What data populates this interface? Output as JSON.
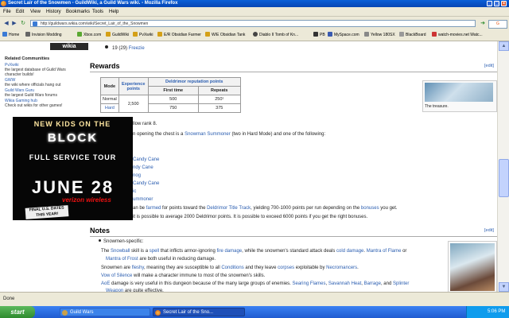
{
  "window": {
    "title": "Secret Lair of the Snowmen - GuildWiki, a Guild Wars wiki. - Mozilla Firefox"
  },
  "menu": [
    "File",
    "Edit",
    "View",
    "History",
    "Bookmarks",
    "Tools",
    "Help"
  ],
  "nav": {
    "url": "http://guildwars.wikia.com/wiki/Secret_Lair_of_the_Snowmen"
  },
  "bookmarks": [
    {
      "label": "Home",
      "color": "#3a7bd5"
    },
    {
      "label": "Invision Modding",
      "color": "#666"
    },
    {
      "label": "Xbox.com",
      "color": "#5aa832"
    },
    {
      "label": "GuildWiki",
      "color": "#d4a017"
    },
    {
      "label": "PvXwiki",
      "color": "#d4a017"
    },
    {
      "label": "E/R Obsidian Farmer",
      "color": "#d4a017"
    },
    {
      "label": "W/E Obsidian Tank",
      "color": "#d4a017"
    },
    {
      "label": "Diablo II Tomb of Kn...",
      "color": "#444"
    },
    {
      "label": "PB",
      "color": "#333"
    },
    {
      "label": "MySpace.com",
      "color": "#3a5bb0"
    },
    {
      "label": "Yellow 180SX",
      "color": "#888"
    },
    {
      "label": "BlackBoard",
      "color": "#999"
    },
    {
      "label": "watch-movies.net Watc...",
      "color": "#c33"
    }
  ],
  "sidebar": {
    "spotlight": "wikia spotlight",
    "heading": "Related Communities",
    "items": [
      {
        "link": "PvXwiki",
        "desc": "the largest database of Guild Wars"
      },
      {
        "link": "",
        "desc": "character builds!"
      },
      {
        "link": "GWW",
        "desc": "the wiki where officials hang out"
      },
      {
        "link": "Guild Wars Guru",
        "desc": "the largest Guild Wars forums"
      },
      {
        "link": "Wikia Gaming hub",
        "desc": "Check out wikis for other games!"
      }
    ]
  },
  "ad": {
    "line1": "NEW KIDS ON THE",
    "line2": "BLOCK",
    "line3": "FULL SERVICE TOUR",
    "line4": "JUNE 28",
    "brand": "verizon wireless",
    "sticker": "FINAL U.S. DATES THIS YEAR!"
  },
  "content": {
    "top_item": {
      "count": "19",
      "paren": "(29)",
      "name": "Freezie"
    },
    "rewards": {
      "heading": "Rewards",
      "edit": "[edit]",
      "table": {
        "col_mode": "Mode",
        "col_exp": "Experience points",
        "col_rep": "Deldrimor reputation points",
        "col_first": "First time",
        "col_repeats": "Repeats",
        "rows": [
          {
            "mode": "Normal",
            "exp": "2,500",
            "first": "500",
            "repeats": "250¹"
          },
          {
            "mode": "Hard",
            "exp": "",
            "first": "750",
            "repeats": "375"
          }
        ]
      },
      "thumb_caption": "The treasure.",
      "rank_text": "llow rank 8.",
      "chest_text": "n opening the chest is a",
      "chest_link": "Snowman Summoner",
      "chest_text2": "(two in Hard Mode) and one of the following:",
      "list": [
        "Candy Cane",
        "ndy Cane",
        "nog",
        "Candy Cane",
        "ic",
        "ummoner"
      ],
      "farm1": "an be",
      "farm_link": "farmed",
      "farm2": "for points toward the",
      "farm_link2": "Deldrimor Title Track",
      "farm3": ", yielding 700-1000 points per run depending on the",
      "farm_link3": "bonuses",
      "farm4": "you get.",
      "avg": "it is possible to average 2000 Deldrimor points. It is possible to exceed 6000 points if you get the right bonuses."
    },
    "notes": {
      "heading": "Notes",
      "edit": "[edit]",
      "snowmen": "Snowmen-specific:",
      "b1": [
        "The",
        "Snowball",
        "skill is a",
        "spell",
        "that inflicts armor-ignoring",
        "fire damage",
        ", while the snowmen's standard attack deals",
        "cold damage",
        ".",
        "Mantra of Flame",
        "or"
      ],
      "b1b": [
        "Mantra of Frost",
        "are both useful in reducing damage."
      ],
      "b2": [
        "Snowmen are",
        "fleshy",
        ", meaning they are susceptible to all",
        "Conditions",
        "and they leave",
        "corpses",
        "exploitable by",
        "Necromancers",
        "."
      ],
      "b3": [
        "Vow of Silence",
        "will make a character immune to most of the snowmen's skills."
      ],
      "b4": [
        "AoE",
        "damage is very useful in this dungeon because of the many large groups of enemies.",
        "Searing Flames",
        ",",
        "Savannah Heat",
        ",",
        "Barrage",
        ", and",
        "Splinter"
      ],
      "b4b": [
        "Weapon",
        "are quite effective."
      ]
    }
  },
  "status": {
    "text": "Done"
  },
  "taskbar": {
    "start": "start",
    "tasks": [
      "Guild Wars",
      "Secret Lair of the Sno..."
    ],
    "clock": "5:06 PM"
  }
}
